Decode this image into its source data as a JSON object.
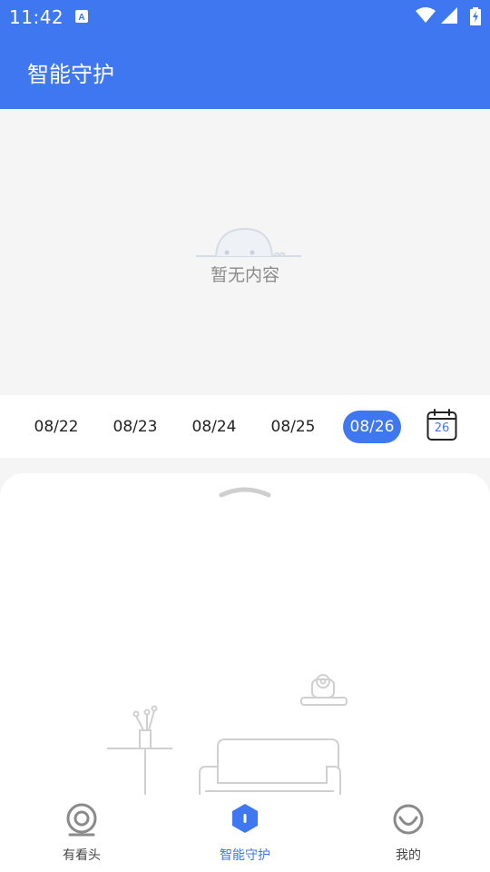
{
  "status_bar": {
    "time": "11:42",
    "icons": [
      "app-a-icon",
      "wifi-icon",
      "signal-icon",
      "battery-charging-icon"
    ]
  },
  "app_bar": {
    "title": "智能守护"
  },
  "empty_state": {
    "text": "暂无内容",
    "icon": "empty-hill-icon"
  },
  "date_bar": {
    "dates": [
      {
        "label": "08/22",
        "selected": false
      },
      {
        "label": "08/23",
        "selected": false
      },
      {
        "label": "08/24",
        "selected": false
      },
      {
        "label": "08/25",
        "selected": false
      },
      {
        "label": "08/26",
        "selected": true
      }
    ],
    "calendar_day": "26",
    "accent_color": "#3f77f0"
  },
  "bottom_sheet": {
    "handle_icon": "chevron-up-icon",
    "illustration": "living-room-illustration"
  },
  "bottom_nav": {
    "items": [
      {
        "label": "有看头",
        "icon": "camera-icon",
        "active": false
      },
      {
        "label": "智能守护",
        "icon": "shield-icon",
        "active": true
      },
      {
        "label": "我的",
        "icon": "profile-smile-icon",
        "active": false
      }
    ]
  },
  "colors": {
    "primary": "#3f77f0",
    "background": "#f5f5f5",
    "text": "#222222",
    "muted": "#8a8a8a"
  }
}
